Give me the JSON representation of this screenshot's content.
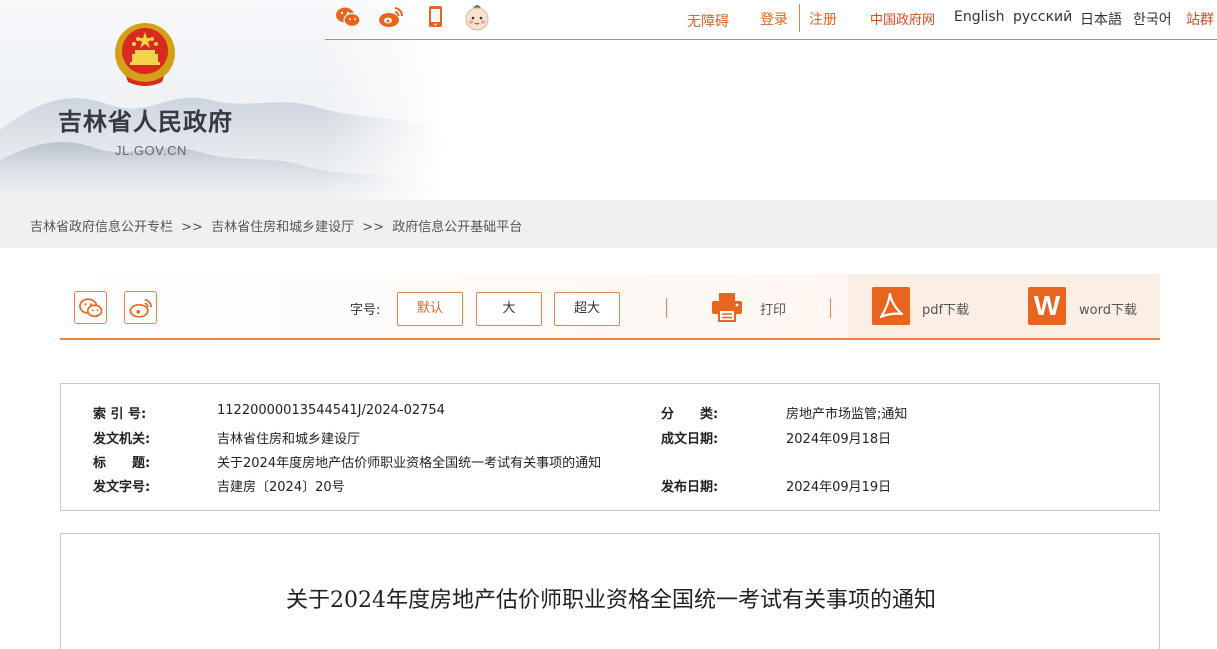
{
  "header": {
    "site_title": "吉林省人民政府",
    "site_domain": "JL.GOV.CN"
  },
  "topbar": {
    "icons": [
      "wechat-icon",
      "weibo-icon",
      "mobile-icon",
      "mascot-icon"
    ],
    "accessibility": "无障碍",
    "login": "登录",
    "register": "注册",
    "links": [
      "中国政府网",
      "English",
      "русский",
      "日本語",
      "한국어",
      "站群"
    ]
  },
  "breadcrumb": {
    "items": [
      "吉林省政府信息公开专栏",
      "吉林省住房和城乡建设厅",
      "政府信息公开基础平台"
    ],
    "separator": ">>"
  },
  "toolbar": {
    "font_size_label": "字号:",
    "font_sizes": [
      "默认",
      "大",
      "超大"
    ],
    "print": "打印",
    "pdf": "pdf下载",
    "word": "word下载",
    "word_icon_letter": "W",
    "accent": "#e8641f"
  },
  "info": {
    "index_label": "索 引 号:",
    "index_value": "11220000013544541J/2024-02754",
    "category_label": "分　　类:",
    "category_value": "房地产市场监管;通知",
    "issuer_label": "发文机关:",
    "issuer_value": "吉林省住房和城乡建设厅",
    "created_label": "成文日期:",
    "created_value": "2024年09月18日",
    "title_label": "标　　题:",
    "title_value": "关于2024年度房地产估价师职业资格全国统一考试有关事项的通知",
    "docno_label": "发文字号:",
    "docno_value": "吉建房〔2024〕20号",
    "published_label": "发布日期:",
    "published_value": "2024年09月19日"
  },
  "article": {
    "title": "关于2024年度房地产估价师职业资格全国统一考试有关事项的通知"
  }
}
